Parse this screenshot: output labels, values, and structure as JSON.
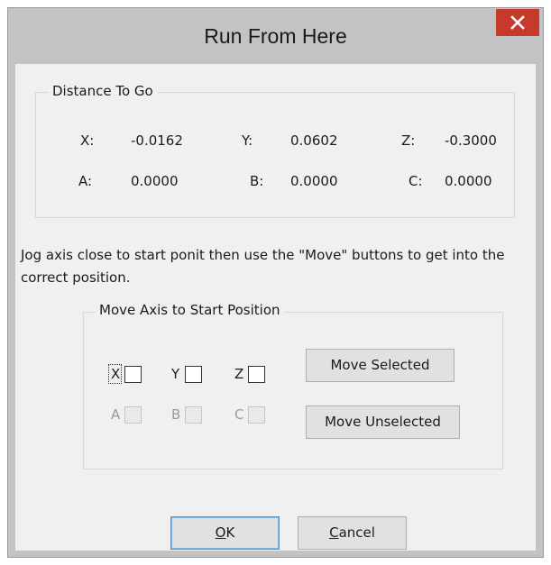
{
  "window": {
    "title": "Run From Here",
    "close_glyph": "✕"
  },
  "distance_to_go": {
    "legend": "Distance To Go",
    "axes": [
      {
        "label": "X:",
        "value": "-0.0162"
      },
      {
        "label": "Y:",
        "value": "0.0602"
      },
      {
        "label": "Z:",
        "value": "-0.3000"
      },
      {
        "label": "A:",
        "value": "0.0000"
      },
      {
        "label": "B:",
        "value": "0.0000"
      },
      {
        "label": "C:",
        "value": "0.0000"
      }
    ]
  },
  "instructions": "Jog axis close to start ponit then use the \"Move\" buttons to get into the correct position.",
  "move_axis": {
    "legend": "Move Axis to Start Position",
    "checkboxes": [
      {
        "label": "X",
        "checked": false,
        "enabled": true,
        "focused": true
      },
      {
        "label": "Y",
        "checked": false,
        "enabled": true
      },
      {
        "label": "Z",
        "checked": false,
        "enabled": true
      },
      {
        "label": "A",
        "checked": false,
        "enabled": false
      },
      {
        "label": "B",
        "checked": false,
        "enabled": false
      },
      {
        "label": "C",
        "checked": false,
        "enabled": false
      }
    ],
    "move_selected_label": "Move Selected",
    "move_unselected_label": "Move Unselected"
  },
  "buttons": {
    "ok_mnemonic": "O",
    "ok_rest": "K",
    "cancel_mnemonic": "C",
    "cancel_rest": "ancel"
  },
  "colors": {
    "close_button": "#c7392b",
    "frame": "#c3c3c3",
    "client": "#f0f0f0",
    "default_button_border": "#5a8fd6"
  }
}
